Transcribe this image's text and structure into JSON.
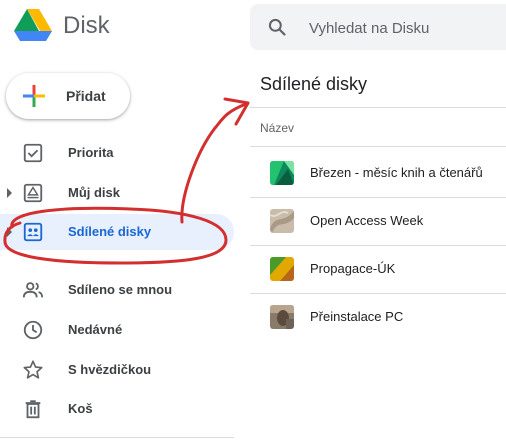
{
  "header": {
    "app_name": "Disk",
    "search_placeholder": "Vyhledat na Disku"
  },
  "sidebar": {
    "new_label": "Přidat",
    "items": [
      {
        "label": "Priorita"
      },
      {
        "label": "Můj disk"
      },
      {
        "label": "Sdílené disky"
      },
      {
        "label": "Sdíleno se mnou"
      },
      {
        "label": "Nedávné"
      },
      {
        "label": "S hvězdičkou"
      },
      {
        "label": "Koš"
      }
    ]
  },
  "main": {
    "title": "Sdílené disky",
    "column_header": "Název",
    "drives": [
      {
        "name": "Březen - měsíc knih a čtenářů"
      },
      {
        "name": "Open Access Week"
      },
      {
        "name": "Propagace-ÚK"
      },
      {
        "name": "Přeinstalace PC"
      }
    ]
  },
  "colors": {
    "active_bg": "#e8f0fe",
    "active_text": "#1967d2",
    "annotation": "#d32f2f"
  }
}
